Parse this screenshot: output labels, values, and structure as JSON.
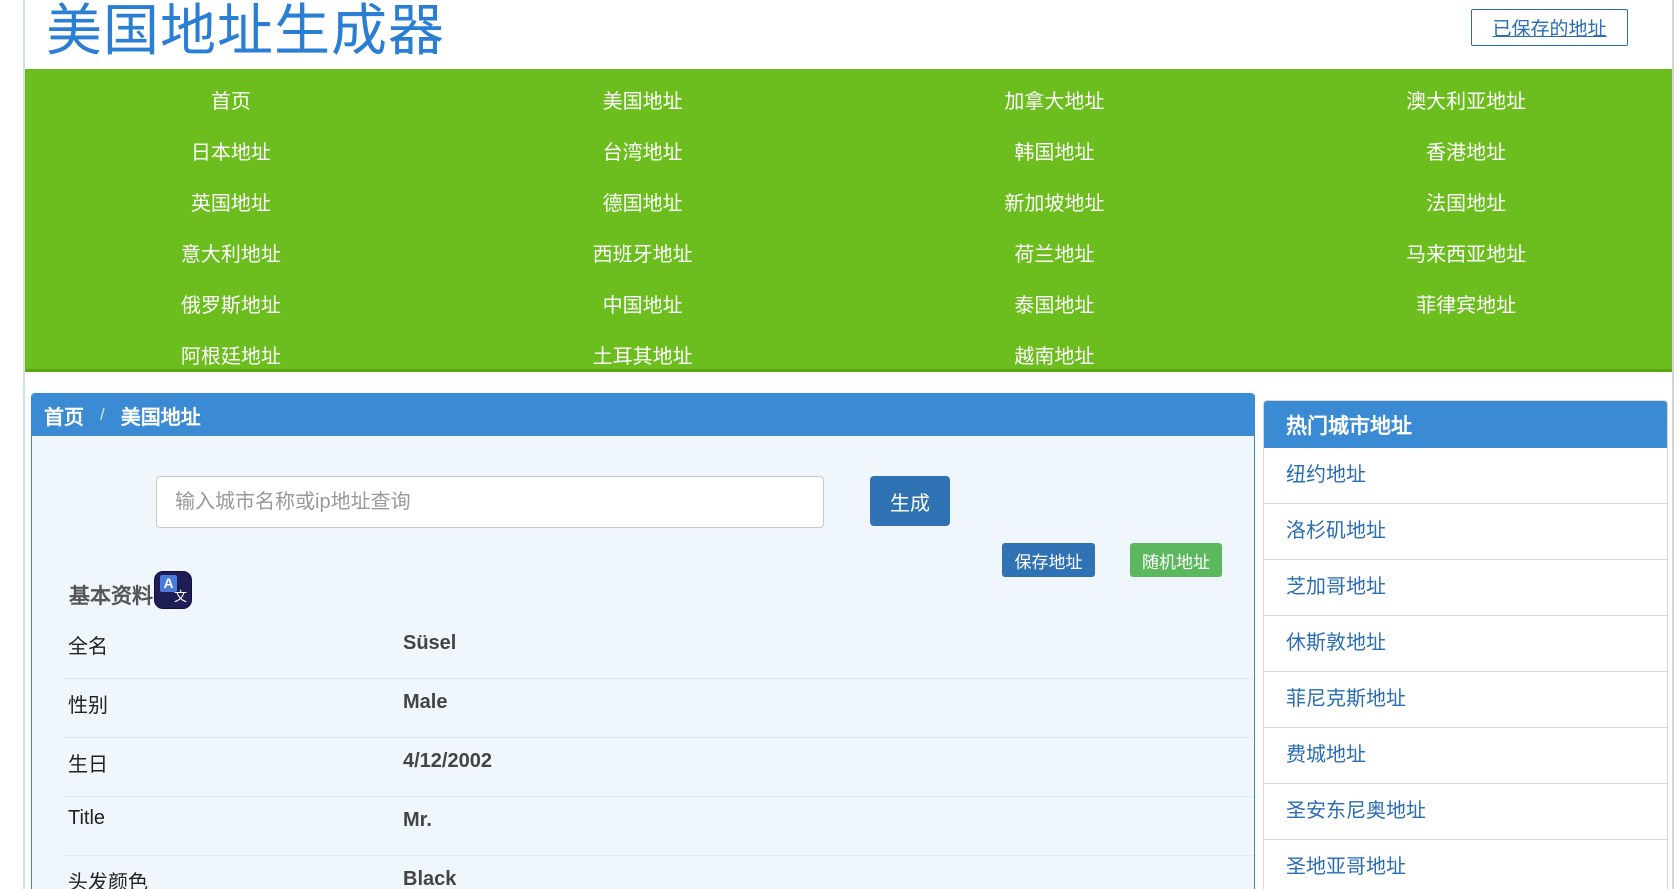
{
  "header": {
    "site_title": "美国地址生成器",
    "saved_button": "已保存的地址"
  },
  "nav": {
    "items": [
      "首页",
      "美国地址",
      "加拿大地址",
      "澳大利亚地址",
      "日本地址",
      "台湾地址",
      "韩国地址",
      "香港地址",
      "英国地址",
      "德国地址",
      "新加坡地址",
      "法国地址",
      "意大利地址",
      "西班牙地址",
      "荷兰地址",
      "马来西亚地址",
      "俄罗斯地址",
      "中国地址",
      "泰国地址",
      "菲律宾地址",
      "阿根廷地址",
      "土耳其地址",
      "越南地址"
    ]
  },
  "breadcrumb": {
    "home": "首页",
    "separator": "/",
    "current": "美国地址"
  },
  "search": {
    "placeholder": "输入城市名称或ip地址查询",
    "value": "",
    "generate_button": "生成"
  },
  "actions": {
    "save_button": "保存地址",
    "random_button": "随机地址"
  },
  "profile": {
    "section_title": "基本资料",
    "translate_icon": {
      "big": "A",
      "small": "文"
    },
    "rows": [
      {
        "label": "全名",
        "value": "Süsel"
      },
      {
        "label": "性别",
        "value": "Male"
      },
      {
        "label": "生日",
        "value": "4/12/2002"
      },
      {
        "label": "Title",
        "value": "Mr."
      },
      {
        "label": "头发颜色",
        "value": "Black"
      }
    ]
  },
  "hot_cities": {
    "title": "热门城市地址",
    "items": [
      "纽约地址",
      "洛杉矶地址",
      "芝加哥地址",
      "休斯敦地址",
      "菲尼克斯地址",
      "费城地址",
      "圣安东尼奥地址",
      "圣地亚哥地址"
    ]
  },
  "colors": {
    "nav_green": "#6cbd1e",
    "brand_blue": "#3a8bd4",
    "button_blue": "#2f73b5",
    "button_green": "#5cb85c",
    "title_blue": "#2a7fd4"
  }
}
